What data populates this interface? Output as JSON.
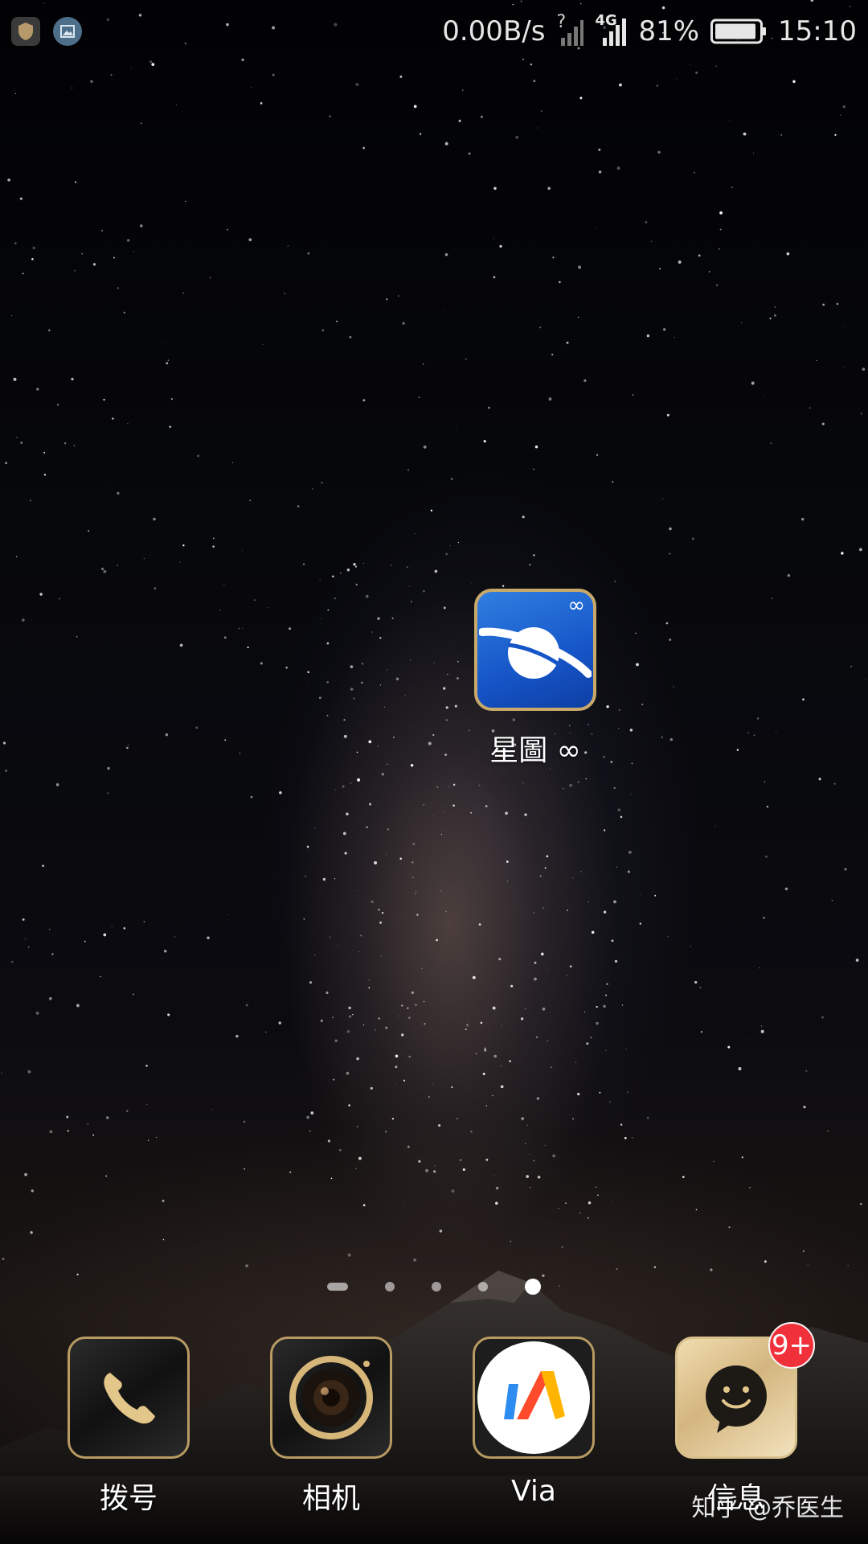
{
  "status_bar": {
    "net_speed": "0.00B/s",
    "net_type": "4G",
    "unknown_signal": "?",
    "battery": "81%",
    "time": "15:10",
    "icons": [
      "shield-icon",
      "gallery-icon",
      "signal-icon",
      "battery-icon"
    ]
  },
  "home": {
    "app": {
      "label": "星圖 ∞",
      "icon": "planet-icon",
      "corner_glyph": "∞"
    }
  },
  "pager": {
    "page_count": 5,
    "active_page": 5
  },
  "dock": {
    "apps": [
      {
        "label": "拨号",
        "icon": "phone-icon"
      },
      {
        "label": "相机",
        "icon": "camera-icon"
      },
      {
        "label": "Via",
        "icon": "via-logo-icon"
      },
      {
        "label": "信息",
        "icon": "message-icon",
        "badge": "9+"
      }
    ]
  },
  "watermark": "知乎 @乔医生",
  "colors": {
    "accent_gold": "#c9a96a",
    "badge_red": "#f0303a",
    "skymap_blue": "#1655c8"
  }
}
